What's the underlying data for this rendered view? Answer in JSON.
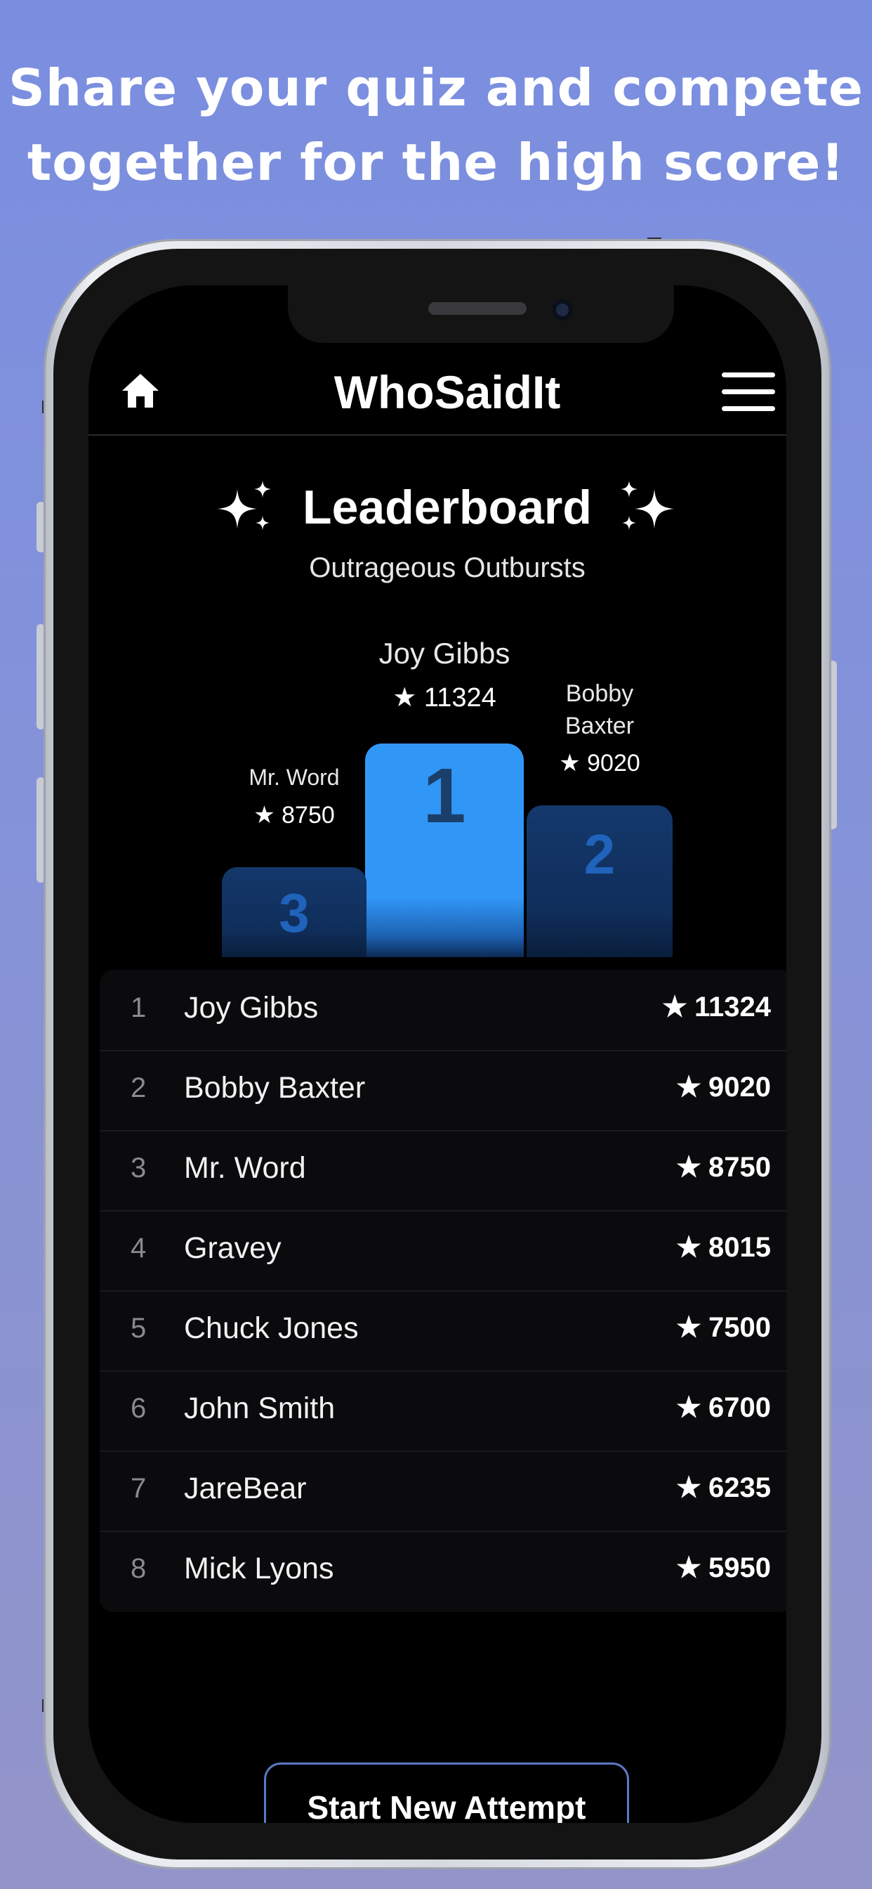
{
  "promo": {
    "line1": "Share your quiz and compete",
    "line2": "together for the high score!"
  },
  "app": {
    "title": "WhoSaidIt",
    "home_icon": "home-icon",
    "menu_icon": "hamburger-menu-icon"
  },
  "leaderboard": {
    "title": "Leaderboard",
    "subtitle": "Outrageous Outbursts",
    "sparkle_icon": "sparkles-icon"
  },
  "podium": {
    "first": {
      "name": "Joy Gibbs",
      "score": "★ 11324",
      "place": "1"
    },
    "second": {
      "name_line1": "Bobby",
      "name_line2": "Baxter",
      "score": "★ 9020",
      "place": "2"
    },
    "third": {
      "name": "Mr. Word",
      "score": "★ 8750",
      "place": "3"
    }
  },
  "rankings": [
    {
      "rank": "1",
      "name": "Joy Gibbs",
      "score": "11324"
    },
    {
      "rank": "2",
      "name": "Bobby Baxter",
      "score": "9020"
    },
    {
      "rank": "3",
      "name": "Mr. Word",
      "score": "8750"
    },
    {
      "rank": "4",
      "name": "Gravey",
      "score": "8015"
    },
    {
      "rank": "5",
      "name": "Chuck Jones",
      "score": "7500"
    },
    {
      "rank": "6",
      "name": "John Smith",
      "score": "6700"
    },
    {
      "rank": "7",
      "name": "JareBear",
      "score": "6235"
    },
    {
      "rank": "8",
      "name": "Mick Lyons",
      "score": "5950"
    }
  ],
  "actions": {
    "start_label": "Start New Attempt"
  },
  "colors": {
    "background_top": "#7a8ee0",
    "background_bottom": "#9394c9",
    "accent_blue": "#3197f6",
    "podium_dark_blue": "#14386c",
    "button_border": "#5b79c4"
  }
}
